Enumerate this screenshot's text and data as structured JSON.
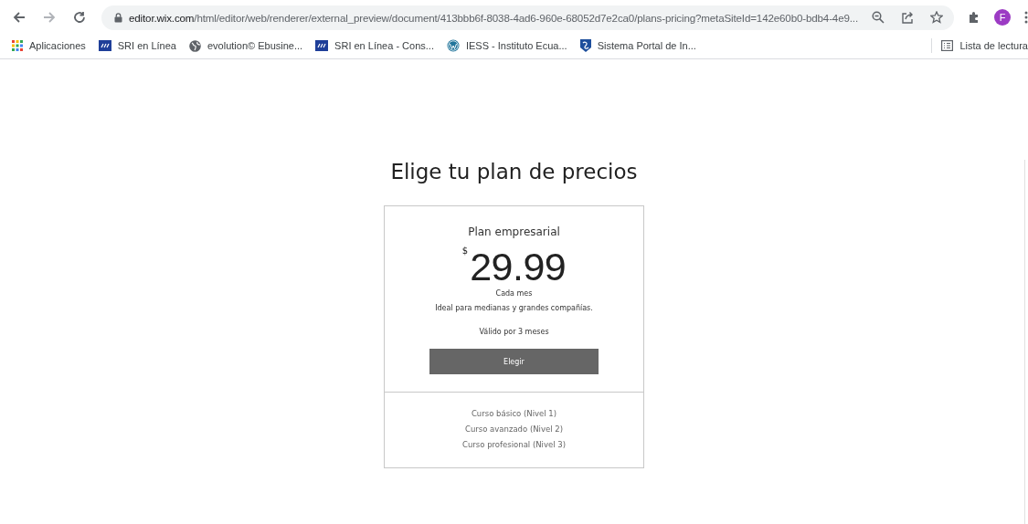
{
  "browser": {
    "url": {
      "host": "editor.wix.com",
      "path": "/html/editor/web/renderer/external_preview/document/413bbb6f-8038-4ad6-960e-68052d7e2ca0/plans-pricing?metaSiteId=142e60b0-bdb4-4e9..."
    },
    "profile_initial": "F",
    "bookmarks": [
      {
        "kind": "apps",
        "label": "Aplicaciones"
      },
      {
        "kind": "sri",
        "label": "SRI en Línea"
      },
      {
        "kind": "globe",
        "label": "evolution© Ebusine..."
      },
      {
        "kind": "sri",
        "label": "SRI en Línea - Cons..."
      },
      {
        "kind": "wordpress",
        "label": "IESS - Instituto Ecua..."
      },
      {
        "kind": "shield",
        "label": "Sistema Portal de In..."
      }
    ],
    "reading_list": "Lista de lectura"
  },
  "page": {
    "title": "Elige tu plan de precios",
    "plan": {
      "name": "Plan empresarial",
      "currency": "$",
      "price": "29.99",
      "period": "Cada mes",
      "description": "Ideal para medianas y grandes compañías.",
      "validity": "Válido por 3 meses",
      "button": "Elegir",
      "features": [
        "Curso básico (Nivel 1)",
        "Curso avanzado (Nivel 2)",
        "Curso profesional (Nivel 3)"
      ]
    }
  }
}
